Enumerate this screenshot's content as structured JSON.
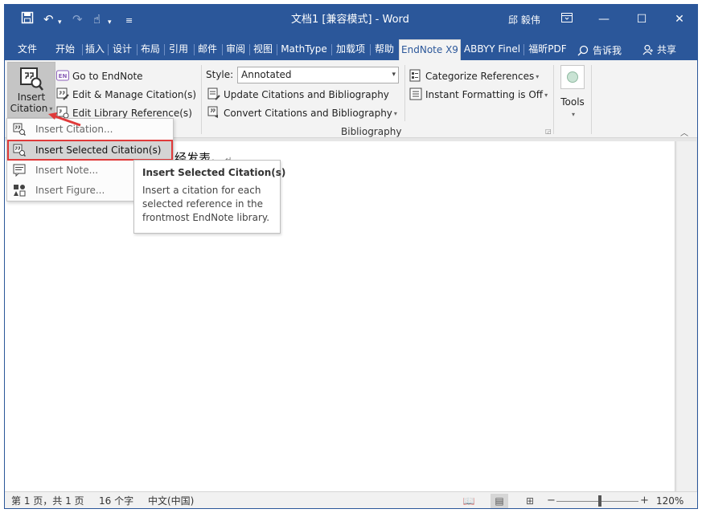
{
  "titlebar": {
    "title": "文档1 [兼容模式]  -  Word",
    "user": "邱 毅伟",
    "quick_access": {
      "save_icon": "save-icon",
      "undo_icon": "undo-icon",
      "redo_icon": "redo-icon",
      "touch_icon": "touch-mode-icon",
      "customize_icon": "customize-qat-icon"
    },
    "window_buttons": {
      "ribbon_display_icon": "ribbon-display-options-icon",
      "minimize_icon": "minimize-icon",
      "maximize_icon": "maximize-icon",
      "close_icon": "close-icon"
    }
  },
  "tabs": [
    "文件",
    "开始",
    "插入",
    "设计",
    "布局",
    "引用",
    "邮件",
    "审阅",
    "视图",
    "MathType",
    "加载项",
    "帮助",
    "EndNote X9",
    "ABBYY Finel",
    "福昕PDF"
  ],
  "active_tab": "EndNote X9",
  "tell_me": "告诉我",
  "share": "共享",
  "ribbon": {
    "insert_citation": {
      "line1": "Insert",
      "line2": "Citation"
    },
    "go_to_endnote": "Go to EndNote",
    "edit_manage": "Edit & Manage Citation(s)",
    "edit_library": "Edit Library Reference(s)",
    "style_label": "Style:",
    "style_value": "Annotated",
    "update_citations": "Update Citations and Bibliography",
    "convert_citations": "Convert Citations and Bibliography",
    "categorize": "Categorize References",
    "instant_formatting": "Instant Formatting is Off",
    "group_label": "Bibliography",
    "tools": "Tools"
  },
  "menu": {
    "items": [
      {
        "label": "Insert Citation...",
        "icon": "insert-citation-icon"
      },
      {
        "label": "Insert Selected Citation(s)",
        "icon": "insert-selected-citation-icon"
      },
      {
        "label": "Insert Note...",
        "icon": "insert-note-icon"
      },
      {
        "label": "Insert Figure...",
        "icon": "insert-figure-icon"
      }
    ],
    "highlighted_index": 1
  },
  "tooltip": {
    "title": "Insert Selected Citation(s)",
    "body": "Insert a citation for each selected reference in the frontmost EndNote library."
  },
  "document": {
    "visible_text": "已经发表。"
  },
  "statusbar": {
    "page": "第 1 页，共 1 页",
    "words": "16 个字",
    "language": "中文(中国)",
    "zoom": "120%",
    "zoom_percent": 120
  },
  "colors": {
    "word_blue": "#2b579a",
    "annotation_red": "#e03a3a",
    "ribbon_bg": "#f3f3f3"
  }
}
